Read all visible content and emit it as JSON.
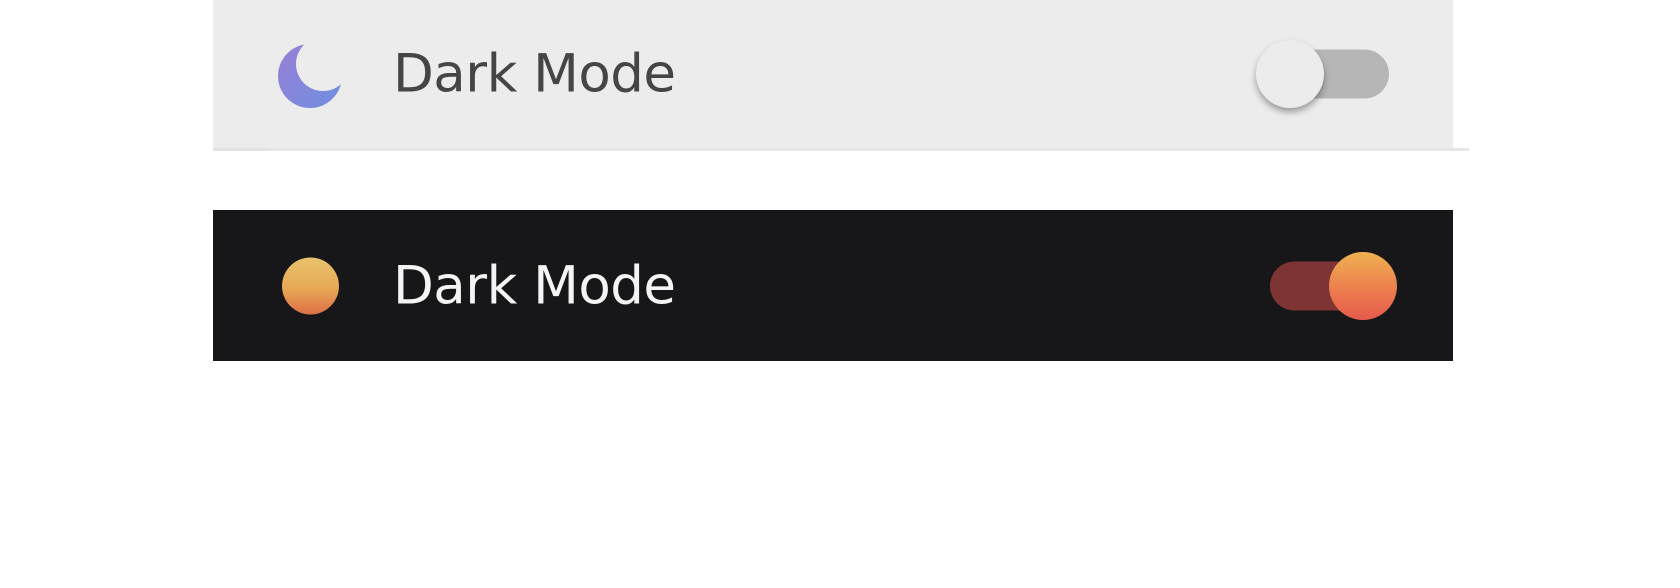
{
  "settings": {
    "light_row": {
      "label": "Dark Mode",
      "icon": "moon-icon",
      "toggle_state": false,
      "background_color": "#ececec",
      "text_color": "#454545"
    },
    "dark_row": {
      "label": "Dark Mode",
      "icon": "sun-icon",
      "toggle_state": true,
      "background_color": "#171719",
      "text_color": "#f4f4f4"
    }
  },
  "colors": {
    "moon_gradient": [
      "#9a7fd6",
      "#7a8ce0"
    ],
    "sun_gradient": [
      "#e8c36d",
      "#de6e47"
    ],
    "toggle_on_track": "#7e3433",
    "toggle_on_knob": [
      "#eeb150",
      "#e65a4c"
    ],
    "toggle_off_track": "#b6b6b6",
    "toggle_off_knob": "#ececec"
  }
}
